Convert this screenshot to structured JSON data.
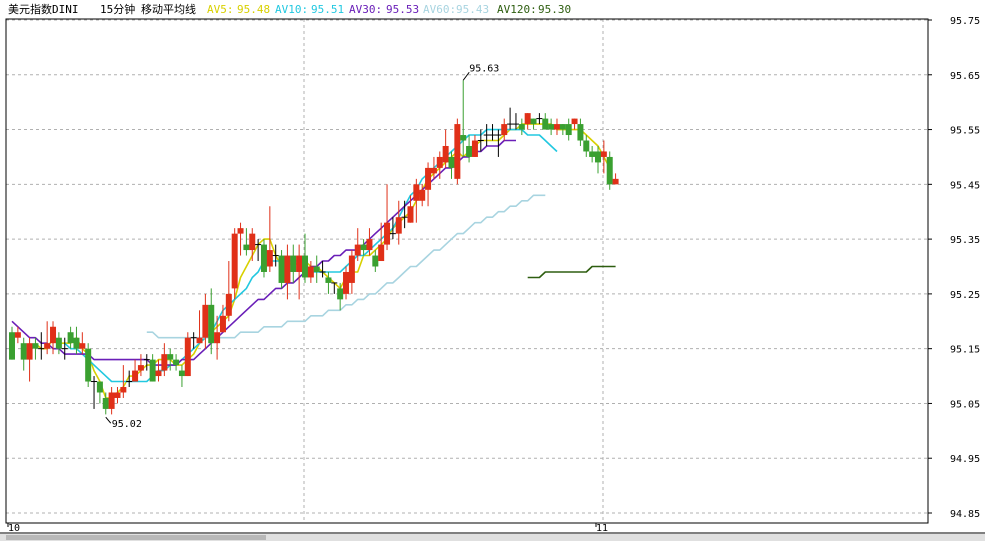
{
  "header": {
    "instrument": "美元指数DINI",
    "period": "15分钟",
    "indicator": "移动平均线",
    "ma": [
      {
        "label": "AV5:",
        "value": "95.48",
        "color": "#d8d000"
      },
      {
        "label": "AV10:",
        "value": "95.51",
        "color": "#22c8e0"
      },
      {
        "label": "AV30:",
        "value": "95.53",
        "color": "#6a1fb8"
      },
      {
        "label": "AV60:",
        "value": "95.43",
        "color": "#a8d4e0"
      },
      {
        "label": "AV120:",
        "value": "95.30",
        "color": "#2e5e10"
      }
    ]
  },
  "chart_data": {
    "type": "candlestick",
    "title": "美元指数DINI 15分钟 移动平均线",
    "ylim": [
      94.84,
      95.78
    ],
    "y_ticks": [
      "95.75",
      "95.65",
      "95.55",
      "95.45",
      "95.35",
      "95.25",
      "95.15",
      "95.05",
      "94.95",
      "94.85"
    ],
    "x_labels": [
      {
        "label": "10",
        "index": 0
      },
      {
        "label": "11",
        "index": 66
      }
    ],
    "annotations": [
      {
        "text": "95.63",
        "index": 77,
        "value": 95.64,
        "kind": "high"
      },
      {
        "text": "95.02",
        "index": 16,
        "value": 95.025,
        "kind": "low"
      }
    ],
    "up_color": "#e03018",
    "down_color": "#3aa030",
    "candles": [
      [
        95.18,
        95.13,
        95.19,
        95.13
      ],
      [
        95.17,
        95.18,
        95.19,
        95.16
      ],
      [
        95.16,
        95.13,
        95.17,
        95.11
      ],
      [
        95.13,
        95.16,
        95.17,
        95.09
      ],
      [
        95.16,
        95.15,
        95.17,
        95.13
      ],
      [
        95.15,
        95.15,
        95.18,
        95.13
      ],
      [
        95.15,
        95.16,
        95.2,
        95.14
      ],
      [
        95.16,
        95.19,
        95.2,
        95.14
      ],
      [
        95.17,
        95.15,
        95.18,
        95.14
      ],
      [
        95.15,
        95.15,
        95.17,
        95.13
      ],
      [
        95.18,
        95.16,
        95.19,
        95.15
      ],
      [
        95.17,
        95.15,
        95.19,
        95.14
      ],
      [
        95.15,
        95.16,
        95.18,
        95.14
      ],
      [
        95.15,
        95.09,
        95.16,
        95.08
      ],
      [
        95.09,
        95.09,
        95.1,
        95.04
      ],
      [
        95.09,
        95.07,
        95.09,
        95.05
      ],
      [
        95.06,
        95.04,
        95.07,
        95.03
      ],
      [
        95.04,
        95.07,
        95.08,
        95.03
      ],
      [
        95.06,
        95.07,
        95.08,
        95.05
      ],
      [
        95.07,
        95.08,
        95.12,
        95.06
      ],
      [
        95.09,
        95.09,
        95.11,
        95.08
      ],
      [
        95.09,
        95.11,
        95.13,
        95.09
      ],
      [
        95.11,
        95.12,
        95.14,
        95.1
      ],
      [
        95.13,
        95.13,
        95.14,
        95.11
      ],
      [
        95.13,
        95.09,
        95.14,
        95.09
      ],
      [
        95.1,
        95.11,
        95.13,
        95.09
      ],
      [
        95.11,
        95.14,
        95.16,
        95.1
      ],
      [
        95.14,
        95.13,
        95.15,
        95.11
      ],
      [
        95.13,
        95.12,
        95.14,
        95.11
      ],
      [
        95.11,
        95.1,
        95.12,
        95.08
      ],
      [
        95.1,
        95.17,
        95.18,
        95.1
      ],
      [
        95.17,
        95.17,
        95.18,
        95.15
      ],
      [
        95.16,
        95.17,
        95.22,
        95.16
      ],
      [
        95.17,
        95.23,
        95.25,
        95.15
      ],
      [
        95.23,
        95.16,
        95.26,
        95.14
      ],
      [
        95.16,
        95.18,
        95.21,
        95.13
      ],
      [
        95.18,
        95.21,
        95.23,
        95.18
      ],
      [
        95.21,
        95.25,
        95.31,
        95.2
      ],
      [
        95.26,
        95.36,
        95.37,
        95.24
      ],
      [
        95.36,
        95.37,
        95.38,
        95.32
      ],
      [
        95.34,
        95.33,
        95.37,
        95.32
      ],
      [
        95.33,
        95.36,
        95.37,
        95.31
      ],
      [
        95.34,
        95.34,
        95.35,
        95.31
      ],
      [
        95.34,
        95.29,
        95.35,
        95.28
      ],
      [
        95.3,
        95.33,
        95.41,
        95.29
      ],
      [
        95.32,
        95.32,
        95.34,
        95.3
      ],
      [
        95.32,
        95.27,
        95.33,
        95.26
      ],
      [
        95.27,
        95.32,
        95.34,
        95.24
      ],
      [
        95.32,
        95.29,
        95.34,
        95.27
      ],
      [
        95.29,
        95.32,
        95.34,
        95.24
      ],
      [
        95.32,
        95.28,
        95.36,
        95.27
      ],
      [
        95.28,
        95.3,
        95.31,
        95.27
      ],
      [
        95.3,
        95.29,
        95.32,
        95.27
      ],
      [
        95.29,
        95.29,
        95.31,
        95.28
      ],
      [
        95.28,
        95.27,
        95.29,
        95.25
      ],
      [
        95.27,
        95.27,
        95.27,
        95.25
      ],
      [
        95.26,
        95.24,
        95.27,
        95.22
      ],
      [
        95.25,
        95.29,
        95.3,
        95.24
      ],
      [
        95.27,
        95.32,
        95.33,
        95.25
      ],
      [
        95.32,
        95.34,
        95.37,
        95.31
      ],
      [
        95.34,
        95.33,
        95.35,
        95.32
      ],
      [
        95.33,
        95.35,
        95.37,
        95.32
      ],
      [
        95.32,
        95.3,
        95.33,
        95.29
      ],
      [
        95.31,
        95.34,
        95.38,
        95.31
      ],
      [
        95.34,
        95.38,
        95.45,
        95.33
      ],
      [
        95.36,
        95.36,
        95.39,
        95.35
      ],
      [
        95.36,
        95.39,
        95.42,
        95.34
      ],
      [
        95.39,
        95.39,
        95.42,
        95.37
      ],
      [
        95.38,
        95.41,
        95.43,
        95.38
      ],
      [
        95.42,
        95.45,
        95.46,
        95.38
      ],
      [
        95.42,
        95.44,
        95.45,
        95.41
      ],
      [
        95.44,
        95.48,
        95.49,
        95.41
      ],
      [
        95.47,
        95.48,
        95.5,
        95.46
      ],
      [
        95.48,
        95.5,
        95.51,
        95.46
      ],
      [
        95.49,
        95.52,
        95.55,
        95.48
      ],
      [
        95.5,
        95.48,
        95.51,
        95.46
      ],
      [
        95.46,
        95.56,
        95.57,
        95.45
      ],
      [
        95.54,
        95.53,
        95.64,
        95.5
      ],
      [
        95.52,
        95.5,
        95.54,
        95.49
      ],
      [
        95.5,
        95.53,
        95.54,
        95.5
      ],
      [
        95.53,
        95.53,
        95.55,
        95.51
      ],
      [
        95.54,
        95.54,
        95.56,
        95.52
      ],
      [
        95.54,
        95.54,
        95.56,
        95.53
      ],
      [
        95.54,
        95.54,
        95.55,
        95.5
      ],
      [
        95.54,
        95.56,
        95.57,
        95.53
      ],
      [
        95.56,
        95.56,
        95.59,
        95.55
      ],
      [
        95.56,
        95.56,
        95.58,
        95.55
      ],
      [
        95.56,
        95.55,
        95.57,
        95.54
      ],
      [
        95.56,
        95.58,
        95.58,
        95.55
      ],
      [
        95.57,
        95.56,
        95.57,
        95.55
      ],
      [
        95.57,
        95.57,
        95.58,
        95.56
      ],
      [
        95.57,
        95.55,
        95.58,
        95.55
      ],
      [
        95.56,
        95.55,
        95.57,
        95.54
      ],
      [
        95.55,
        95.56,
        95.57,
        95.54
      ],
      [
        95.56,
        95.55,
        95.56,
        95.54
      ],
      [
        95.56,
        95.54,
        95.57,
        95.53
      ],
      [
        95.56,
        95.57,
        95.57,
        95.55
      ],
      [
        95.56,
        95.53,
        95.57,
        95.52
      ],
      [
        95.53,
        95.51,
        95.54,
        95.5
      ],
      [
        95.51,
        95.5,
        95.52,
        95.49
      ],
      [
        95.51,
        95.49,
        95.52,
        95.47
      ],
      [
        95.5,
        95.51,
        95.53,
        95.47
      ],
      [
        95.5,
        95.45,
        95.51,
        95.44
      ],
      [
        95.45,
        95.46,
        95.47,
        95.45
      ]
    ],
    "series": [
      {
        "name": "AV5",
        "color": "#d8d000",
        "start": 4,
        "values": [
          95.16,
          95.15,
          95.15,
          95.17,
          95.16,
          95.16,
          95.16,
          95.17,
          95.15,
          95.14,
          95.11,
          95.09,
          95.06,
          95.06,
          95.07,
          95.08,
          95.1,
          95.1,
          95.11,
          95.12,
          95.12,
          95.13,
          95.13,
          95.13,
          95.12,
          95.12,
          95.13,
          95.14,
          95.16,
          95.17,
          95.18,
          95.19,
          95.2,
          95.21,
          95.24,
          95.28,
          95.3,
          95.32,
          95.34,
          95.35,
          95.35,
          95.32,
          95.3,
          95.31,
          95.3,
          95.31,
          95.31,
          95.3,
          95.3,
          95.29,
          95.28,
          95.27,
          95.26,
          95.28,
          95.29,
          95.29,
          95.32,
          95.32,
          95.33,
          95.34,
          95.35,
          95.37,
          95.38,
          95.39,
          95.4,
          95.42,
          95.44,
          95.46,
          95.47,
          95.48,
          95.49,
          95.5,
          95.51,
          95.5,
          95.51,
          95.52,
          95.53,
          95.53,
          95.53,
          95.53,
          95.54,
          95.55,
          95.55,
          95.56,
          95.56,
          95.56,
          95.56,
          95.56,
          95.56,
          95.55,
          95.55,
          95.55,
          95.55,
          95.55,
          95.54,
          95.53,
          95.52,
          95.5,
          95.48
        ]
      },
      {
        "name": "AV10",
        "color": "#22c8e0",
        "start": 9,
        "values": [
          95.16,
          95.15,
          95.15,
          95.14,
          95.13,
          95.12,
          95.11,
          95.1,
          95.09,
          95.09,
          95.09,
          95.09,
          95.09,
          95.09,
          95.09,
          95.1,
          95.11,
          95.11,
          95.12,
          95.12,
          95.13,
          95.14,
          95.15,
          95.16,
          95.17,
          95.18,
          95.2,
          95.22,
          95.23,
          95.24,
          95.25,
          95.26,
          95.28,
          95.29,
          95.31,
          95.31,
          95.31,
          95.31,
          95.31,
          95.31,
          95.31,
          95.3,
          95.29,
          95.29,
          95.29,
          95.29,
          95.29,
          95.29,
          95.3,
          95.31,
          95.32,
          95.32,
          95.33,
          95.34,
          95.35,
          95.36,
          95.37,
          95.39,
          95.41,
          95.43,
          95.44,
          95.46,
          95.47,
          95.48,
          95.49,
          95.5,
          95.51,
          95.52,
          95.53,
          95.54,
          95.54,
          95.54,
          95.55,
          95.55,
          95.55,
          95.55,
          95.55,
          95.55,
          95.55,
          95.54,
          95.54,
          95.54,
          95.53,
          95.52,
          95.51
        ]
      },
      {
        "name": "AV30",
        "color": "#6a1fb8",
        "start": 0,
        "values": [
          95.2,
          95.19,
          95.18,
          95.17,
          95.17,
          95.16,
          95.16,
          95.15,
          95.15,
          95.14,
          95.14,
          95.14,
          95.14,
          95.14,
          95.13,
          95.13,
          95.13,
          95.13,
          95.13,
          95.13,
          95.13,
          95.13,
          95.13,
          95.13,
          95.12,
          95.12,
          95.12,
          95.12,
          95.12,
          95.13,
          95.13,
          95.13,
          95.14,
          95.15,
          95.16,
          95.17,
          95.18,
          95.19,
          95.2,
          95.21,
          95.22,
          95.23,
          95.24,
          95.24,
          95.25,
          95.26,
          95.26,
          95.27,
          95.27,
          95.28,
          95.29,
          95.3,
          95.3,
          95.31,
          95.31,
          95.32,
          95.32,
          95.33,
          95.33,
          95.33,
          95.34,
          95.35,
          95.36,
          95.37,
          95.38,
          95.39,
          95.4,
          95.41,
          95.42,
          95.43,
          95.44,
          95.45,
          95.46,
          95.47,
          95.48,
          95.48,
          95.49,
          95.5,
          95.5,
          95.51,
          95.51,
          95.52,
          95.52,
          95.52,
          95.53,
          95.53,
          95.53
        ]
      },
      {
        "name": "AV60",
        "color": "#a8d4e0",
        "start": 23,
        "values": [
          95.18,
          95.18,
          95.17,
          95.17,
          95.17,
          95.17,
          95.17,
          95.17,
          95.17,
          95.17,
          95.17,
          95.17,
          95.17,
          95.17,
          95.17,
          95.17,
          95.18,
          95.18,
          95.18,
          95.18,
          95.19,
          95.19,
          95.19,
          95.19,
          95.2,
          95.2,
          95.2,
          95.2,
          95.21,
          95.21,
          95.21,
          95.22,
          95.22,
          95.22,
          95.23,
          95.23,
          95.24,
          95.24,
          95.25,
          95.25,
          95.26,
          95.27,
          95.27,
          95.28,
          95.29,
          95.3,
          95.3,
          95.31,
          95.32,
          95.33,
          95.33,
          95.34,
          95.35,
          95.36,
          95.36,
          95.37,
          95.38,
          95.38,
          95.39,
          95.39,
          95.4,
          95.4,
          95.41,
          95.41,
          95.42,
          95.42,
          95.43,
          95.43,
          95.43
        ]
      },
      {
        "name": "AV120",
        "color": "#2e5e10",
        "start": 88,
        "values": [
          95.28,
          95.28,
          95.28,
          95.29,
          95.29,
          95.29,
          95.29,
          95.29,
          95.29,
          95.29,
          95.29,
          95.3,
          95.3,
          95.3,
          95.3,
          95.3
        ]
      }
    ]
  }
}
